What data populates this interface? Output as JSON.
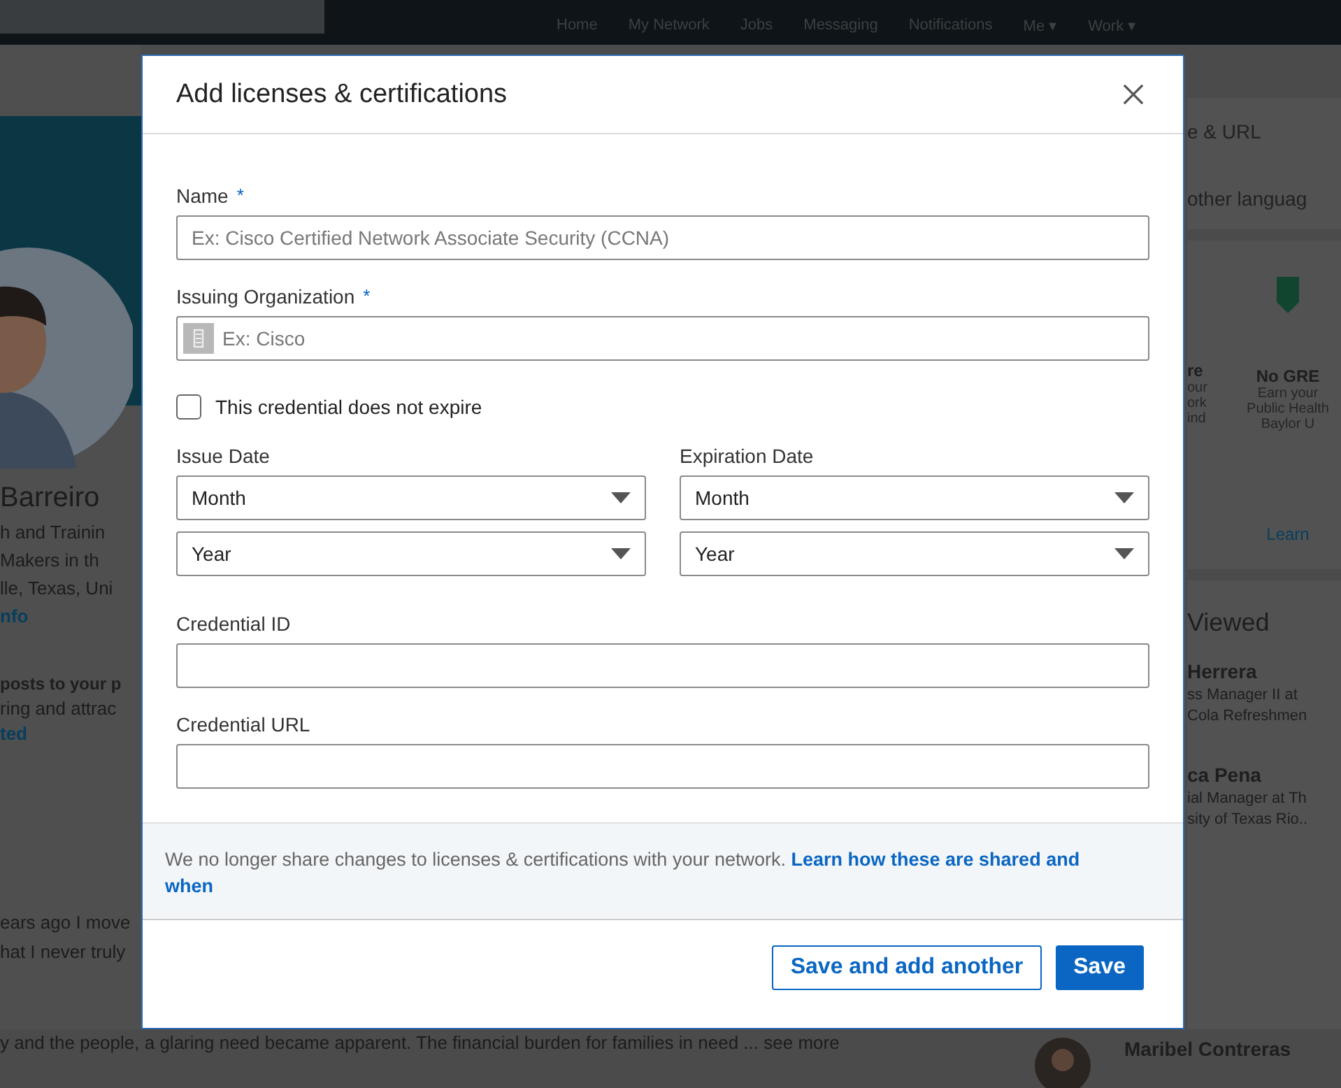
{
  "nav": {
    "items": [
      {
        "label": "Home"
      },
      {
        "label": "My Network"
      },
      {
        "label": "Jobs"
      },
      {
        "label": "Messaging"
      },
      {
        "label": "Notifications"
      },
      {
        "label": "Me ▾"
      },
      {
        "label": "Work ▾"
      }
    ]
  },
  "profile": {
    "name": "Barreiro",
    "lines": [
      "h and Trainin",
      "Makers in th",
      "lle, Texas, Uni"
    ],
    "link": "nfo",
    "promo_title": "posts to your p",
    "promo_text": "ring and attrac",
    "promo_link": "ted",
    "post_lines": [
      "ears ago I move",
      "hat I never truly",
      "y and the people, a glaring need became apparent. The financial burden for families in need ... see more"
    ]
  },
  "right_rail": {
    "top_items": [
      "e & URL",
      "other languag"
    ],
    "ad_left": {
      "title": "re",
      "lines": [
        "our",
        "ork",
        "ind"
      ]
    },
    "ad_right": {
      "title": "No GRE",
      "lines": [
        "Earn your",
        "Public Health",
        "Baylor U"
      ],
      "link": "Learn"
    },
    "viewed_title": "Viewed",
    "people": [
      {
        "name": "Herrera",
        "lines": [
          "ss Manager II at",
          "Cola Refreshmen"
        ]
      },
      {
        "name": "ca Pena",
        "lines": [
          "ial Manager at Th",
          "sity of Texas Rio.."
        ]
      }
    ],
    "last_person": "Maribel Contreras"
  },
  "modal": {
    "title": "Add licenses & certifications",
    "fields": [
      {
        "kind": "text",
        "label": "Name",
        "required_mark": "*",
        "placeholder": "Ex: Cisco Certified Network Associate Security (CCNA)"
      },
      {
        "kind": "org",
        "label": "Issuing Organization",
        "required_mark": "*",
        "placeholder": "Ex: Cisco"
      }
    ],
    "checkbox": {
      "label": "This credential does not expire",
      "checked": false
    },
    "dates": [
      {
        "label": "Issue Date",
        "selects": [
          "Month",
          "Year"
        ]
      },
      {
        "label": "Expiration Date",
        "selects": [
          "Month",
          "Year"
        ]
      }
    ],
    "more_fields": [
      {
        "label": "Credential ID"
      },
      {
        "label": "Credential URL"
      }
    ],
    "notice": {
      "text": "We no longer share changes to licenses & certifications with your network.",
      "link_lines": [
        "Learn how these are shared and",
        "when"
      ]
    },
    "buttons": [
      {
        "kind": "secondary",
        "label": "Save and add another"
      },
      {
        "kind": "primary",
        "label": "Save"
      }
    ]
  }
}
